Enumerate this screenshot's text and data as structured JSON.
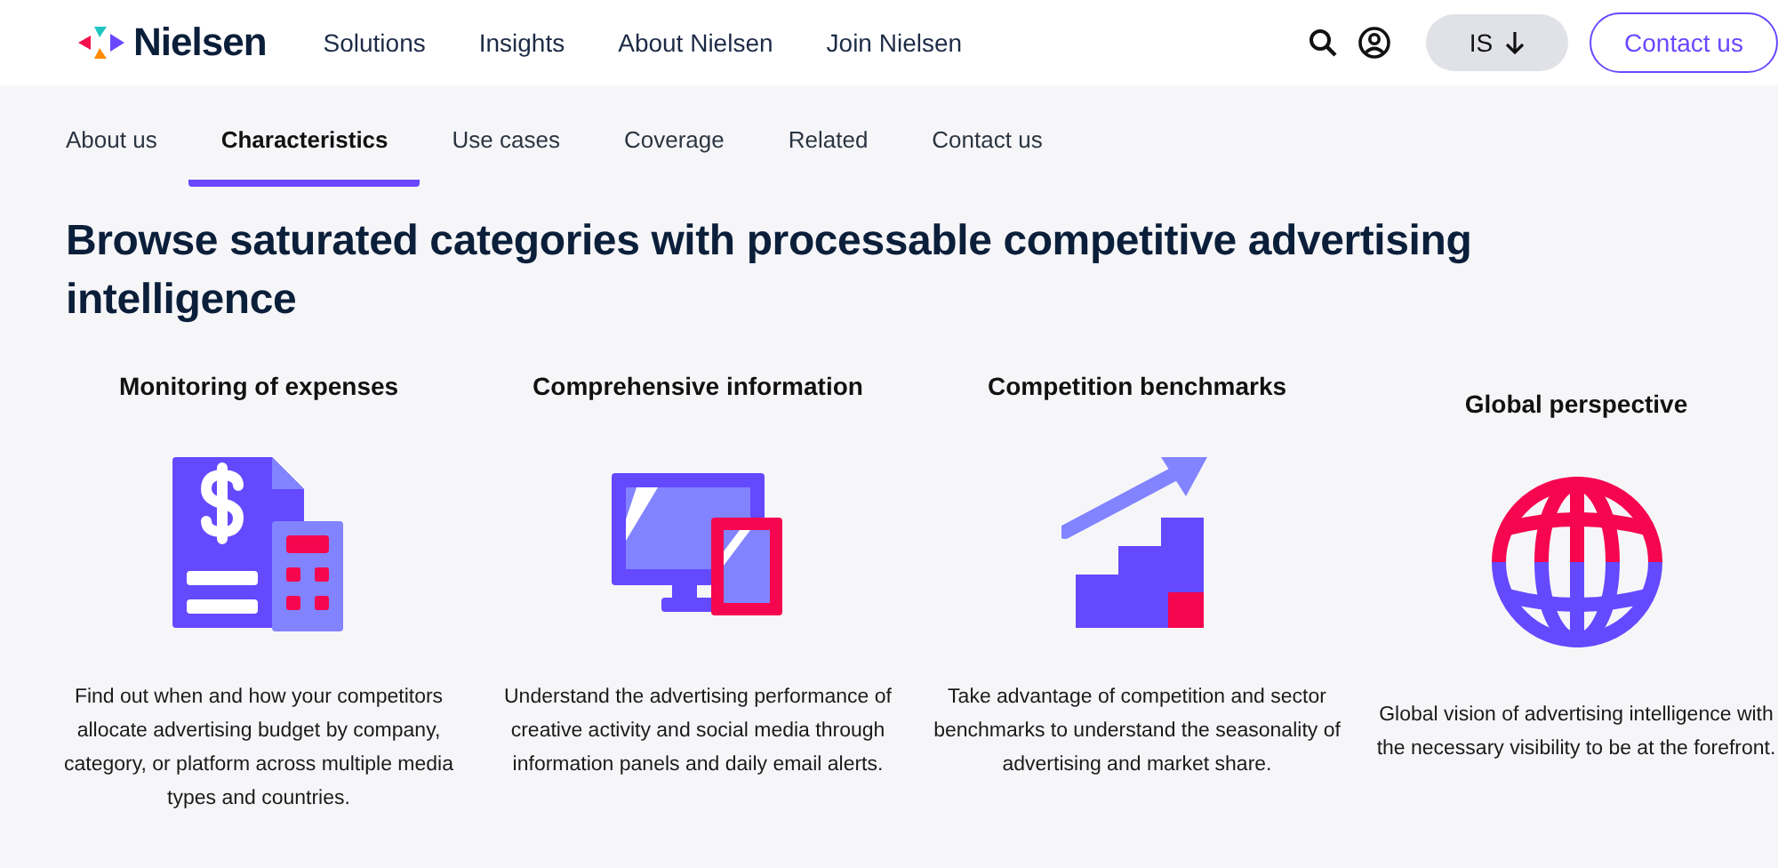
{
  "header": {
    "brand": "Nielsen",
    "nav": [
      "Solutions",
      "Insights",
      "About Nielsen",
      "Join Nielsen"
    ],
    "language_button": "IS",
    "contact_button": "Contact us"
  },
  "tabs": [
    {
      "label": "About us",
      "selected": false
    },
    {
      "label": "Characteristics",
      "selected": true
    },
    {
      "label": "Use cases",
      "selected": false
    },
    {
      "label": "Coverage",
      "selected": false
    },
    {
      "label": "Related",
      "selected": false
    },
    {
      "label": "Contact us",
      "selected": false
    }
  ],
  "heading": "Browse saturated categories with processable competitive advertising intelligence",
  "features": [
    {
      "title": "Monitoring of expenses",
      "text": "Find out when and how your competitors allocate advertising budget by company, category, or platform across multiple media types and countries."
    },
    {
      "title": "Comprehensive information",
      "text": "Understand the advertising performance of creative activity and social media through information panels and daily email alerts."
    },
    {
      "title": "Competition benchmarks",
      "text": "Take advantage of competition and sector benchmarks to understand the seasonality of advertising and market share."
    },
    {
      "title": "Global perspective",
      "text": "Global vision of advertising intelligence with the necessary visibility to be at the forefront."
    }
  ]
}
